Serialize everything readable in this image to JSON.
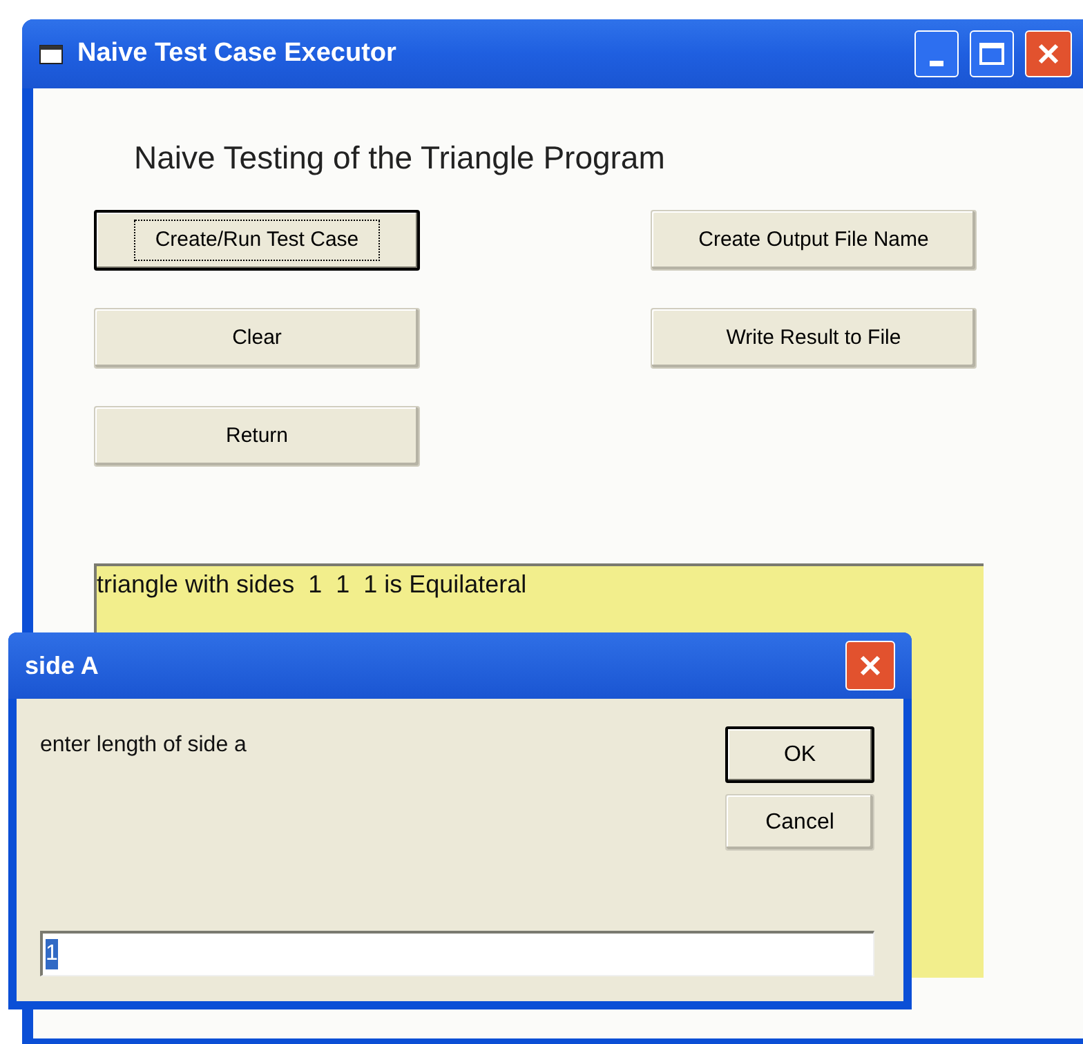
{
  "window": {
    "title": "Naive Test Case Executor"
  },
  "heading": "Naive Testing of the Triangle Program",
  "left_buttons": [
    {
      "label": "Create/Run Test Case",
      "focused": true
    },
    {
      "label": "Clear",
      "focused": false
    },
    {
      "label": "Return",
      "focused": false
    }
  ],
  "right_buttons": [
    {
      "label": "Create Output File Name",
      "focused": false
    },
    {
      "label": "Write Result to File",
      "focused": false
    }
  ],
  "output": {
    "text": "triangle with sides  1  1  1 is Equilateral"
  },
  "dialog": {
    "title": "side A",
    "prompt": "enter length of side a",
    "buttons": [
      {
        "label": "OK",
        "default": true
      },
      {
        "label": "Cancel",
        "default": false
      }
    ],
    "input": {
      "value": "1",
      "text_selected": true
    }
  }
}
